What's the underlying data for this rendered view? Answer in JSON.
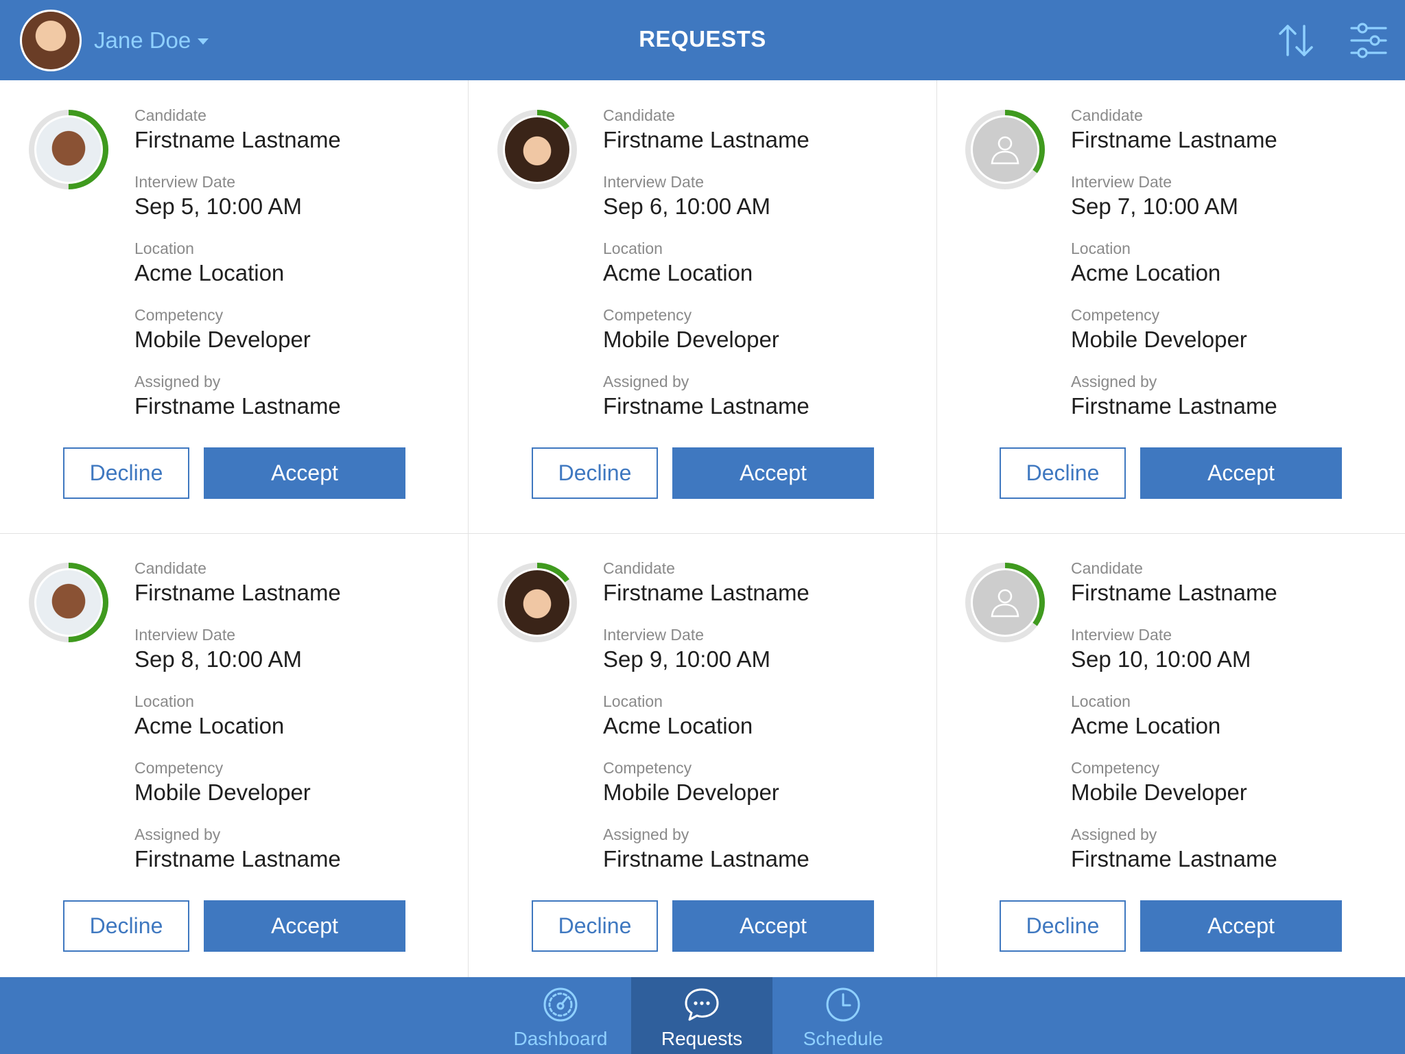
{
  "header": {
    "user_name": "Jane Doe",
    "title": "REQUESTS",
    "sort_icon": "sort-icon",
    "filter_icon": "filter-sliders-icon"
  },
  "labels": {
    "candidate": "Candidate",
    "interview_date": "Interview Date",
    "location": "Location",
    "competency": "Competency",
    "assigned_by": "Assigned by"
  },
  "buttons": {
    "decline": "Decline",
    "accept": "Accept"
  },
  "colors": {
    "primary": "#3f78c0",
    "primary_dark": "#2f5f9c",
    "accent_light": "#8fd0ff",
    "progress_green": "#3f9a1e",
    "ring_track": "#e3e3e3"
  },
  "requests": [
    {
      "candidate": "Firstname Lastname",
      "interview_date": "Sep 5,  10:00 AM",
      "location": "Acme Location",
      "competency": "Mobile Developer",
      "assigned_by": "Firstname Lastname",
      "avatar": "man",
      "progress": 0.5
    },
    {
      "candidate": "Firstname Lastname",
      "interview_date": "Sep 6,  10:00 AM",
      "location": "Acme Location",
      "competency": "Mobile Developer",
      "assigned_by": "Firstname Lastname",
      "avatar": "woman",
      "progress": 0.15
    },
    {
      "candidate": "Firstname Lastname",
      "interview_date": "Sep 7,  10:00 AM",
      "location": "Acme Location",
      "competency": "Mobile Developer",
      "assigned_by": "Firstname Lastname",
      "avatar": "placeholder",
      "progress": 0.35
    },
    {
      "candidate": "Firstname Lastname",
      "interview_date": "Sep 8,  10:00 AM",
      "location": "Acme Location",
      "competency": "Mobile Developer",
      "assigned_by": "Firstname Lastname",
      "avatar": "man",
      "progress": 0.5
    },
    {
      "candidate": "Firstname Lastname",
      "interview_date": "Sep 9,  10:00 AM",
      "location": "Acme Location",
      "competency": "Mobile Developer",
      "assigned_by": "Firstname Lastname",
      "avatar": "woman",
      "progress": 0.15
    },
    {
      "candidate": "Firstname Lastname",
      "interview_date": "Sep 10,  10:00 AM",
      "location": "Acme Location",
      "competency": "Mobile Developer",
      "assigned_by": "Firstname Lastname",
      "avatar": "placeholder",
      "progress": 0.35
    }
  ],
  "tabs": [
    {
      "label": "Dashboard",
      "icon": "dashboard-gauge-icon",
      "active": false
    },
    {
      "label": "Requests",
      "icon": "chat-bubble-icon",
      "active": true
    },
    {
      "label": "Schedule",
      "icon": "clock-icon",
      "active": false
    }
  ]
}
